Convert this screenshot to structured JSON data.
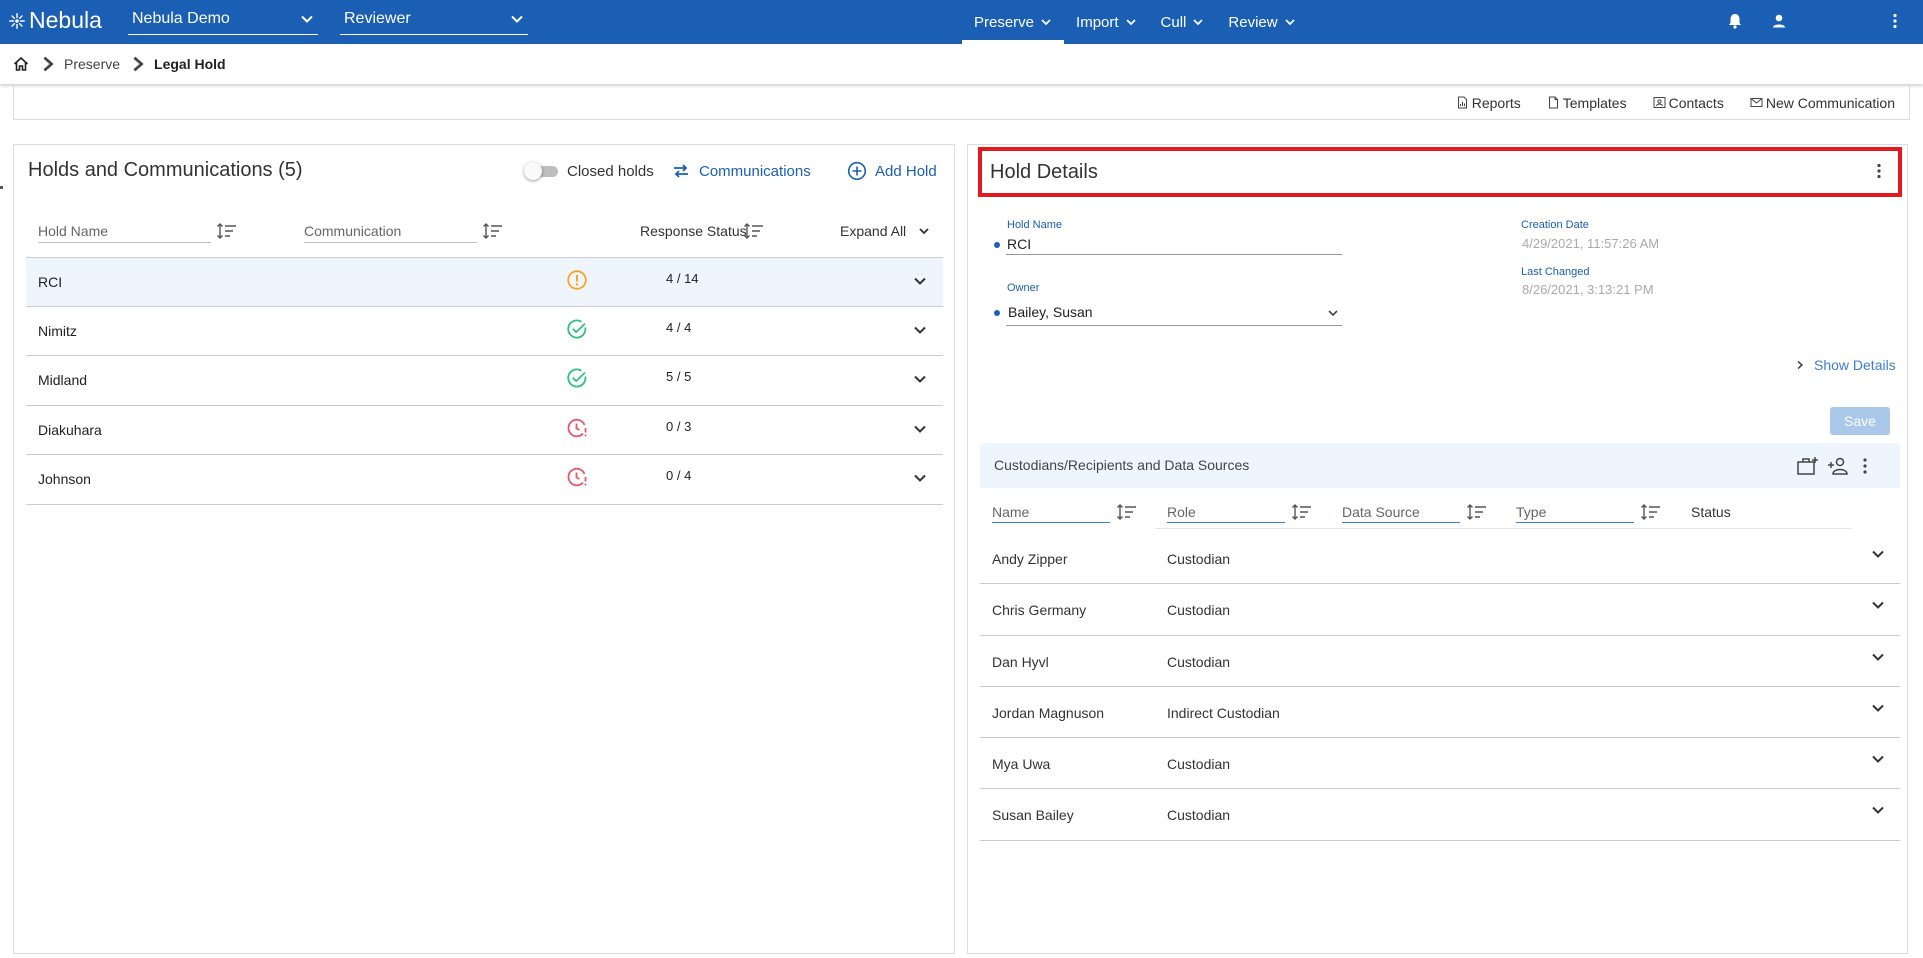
{
  "app": {
    "logo_text": "Nebula",
    "workspace": "Nebula Demo",
    "role": "Reviewer"
  },
  "nav": {
    "items": [
      "Preserve",
      "Import",
      "Cull",
      "Review"
    ],
    "active": "Preserve"
  },
  "breadcrumb": {
    "parent": "Preserve",
    "current": "Legal Hold"
  },
  "subbar": {
    "reports": "Reports",
    "templates": "Templates",
    "contacts": "Contacts",
    "new_communication": "New Communication"
  },
  "holds_panel": {
    "title": "Holds and Communications (5)",
    "closed_holds_label": "Closed holds",
    "communications_label": "Communications",
    "add_hold_label": "Add Hold",
    "columns": {
      "hold_name": "Hold Name",
      "communication": "Communication",
      "response_status": "Response Status",
      "expand_all": "Expand All"
    },
    "rows": [
      {
        "name": "RCI",
        "status": "warning",
        "count": "4 / 14"
      },
      {
        "name": "Nimitz",
        "status": "complete",
        "count": "4 / 4"
      },
      {
        "name": "Midland",
        "status": "complete",
        "count": "5 / 5"
      },
      {
        "name": "Diakuhara",
        "status": "overdue",
        "count": "0 / 3"
      },
      {
        "name": "Johnson",
        "status": "overdue",
        "count": "0 / 4"
      }
    ]
  },
  "hold_details": {
    "title": "Hold Details",
    "hold_name_label": "Hold Name",
    "hold_name_value": "RCI",
    "owner_label": "Owner",
    "owner_value": "Bailey, Susan",
    "creation_date_label": "Creation Date",
    "creation_date_value": "4/29/2021, 11:57:26 AM",
    "last_changed_label": "Last Changed",
    "last_changed_value": "8/26/2021, 3:13:21 PM",
    "show_details_label": "Show Details",
    "save_label": "Save"
  },
  "custodians": {
    "title": "Custodians/Recipients and Data Sources",
    "columns": {
      "name": "Name",
      "role": "Role",
      "data_source": "Data Source",
      "type": "Type",
      "status": "Status"
    },
    "rows": [
      {
        "name": "Andy Zipper",
        "role": "Custodian"
      },
      {
        "name": "Chris Germany",
        "role": "Custodian"
      },
      {
        "name": "Dan Hyvl",
        "role": "Custodian"
      },
      {
        "name": "Jordan Magnuson",
        "role": "Indirect Custodian"
      },
      {
        "name": "Mya Uwa",
        "role": "Custodian"
      },
      {
        "name": "Susan Bailey",
        "role": "Custodian"
      }
    ]
  },
  "colors": {
    "brand": "#1a5fb4",
    "highlight": "#e2191f",
    "warning": "#f5a623",
    "success": "#2ec27e",
    "danger": "#e5566a"
  }
}
